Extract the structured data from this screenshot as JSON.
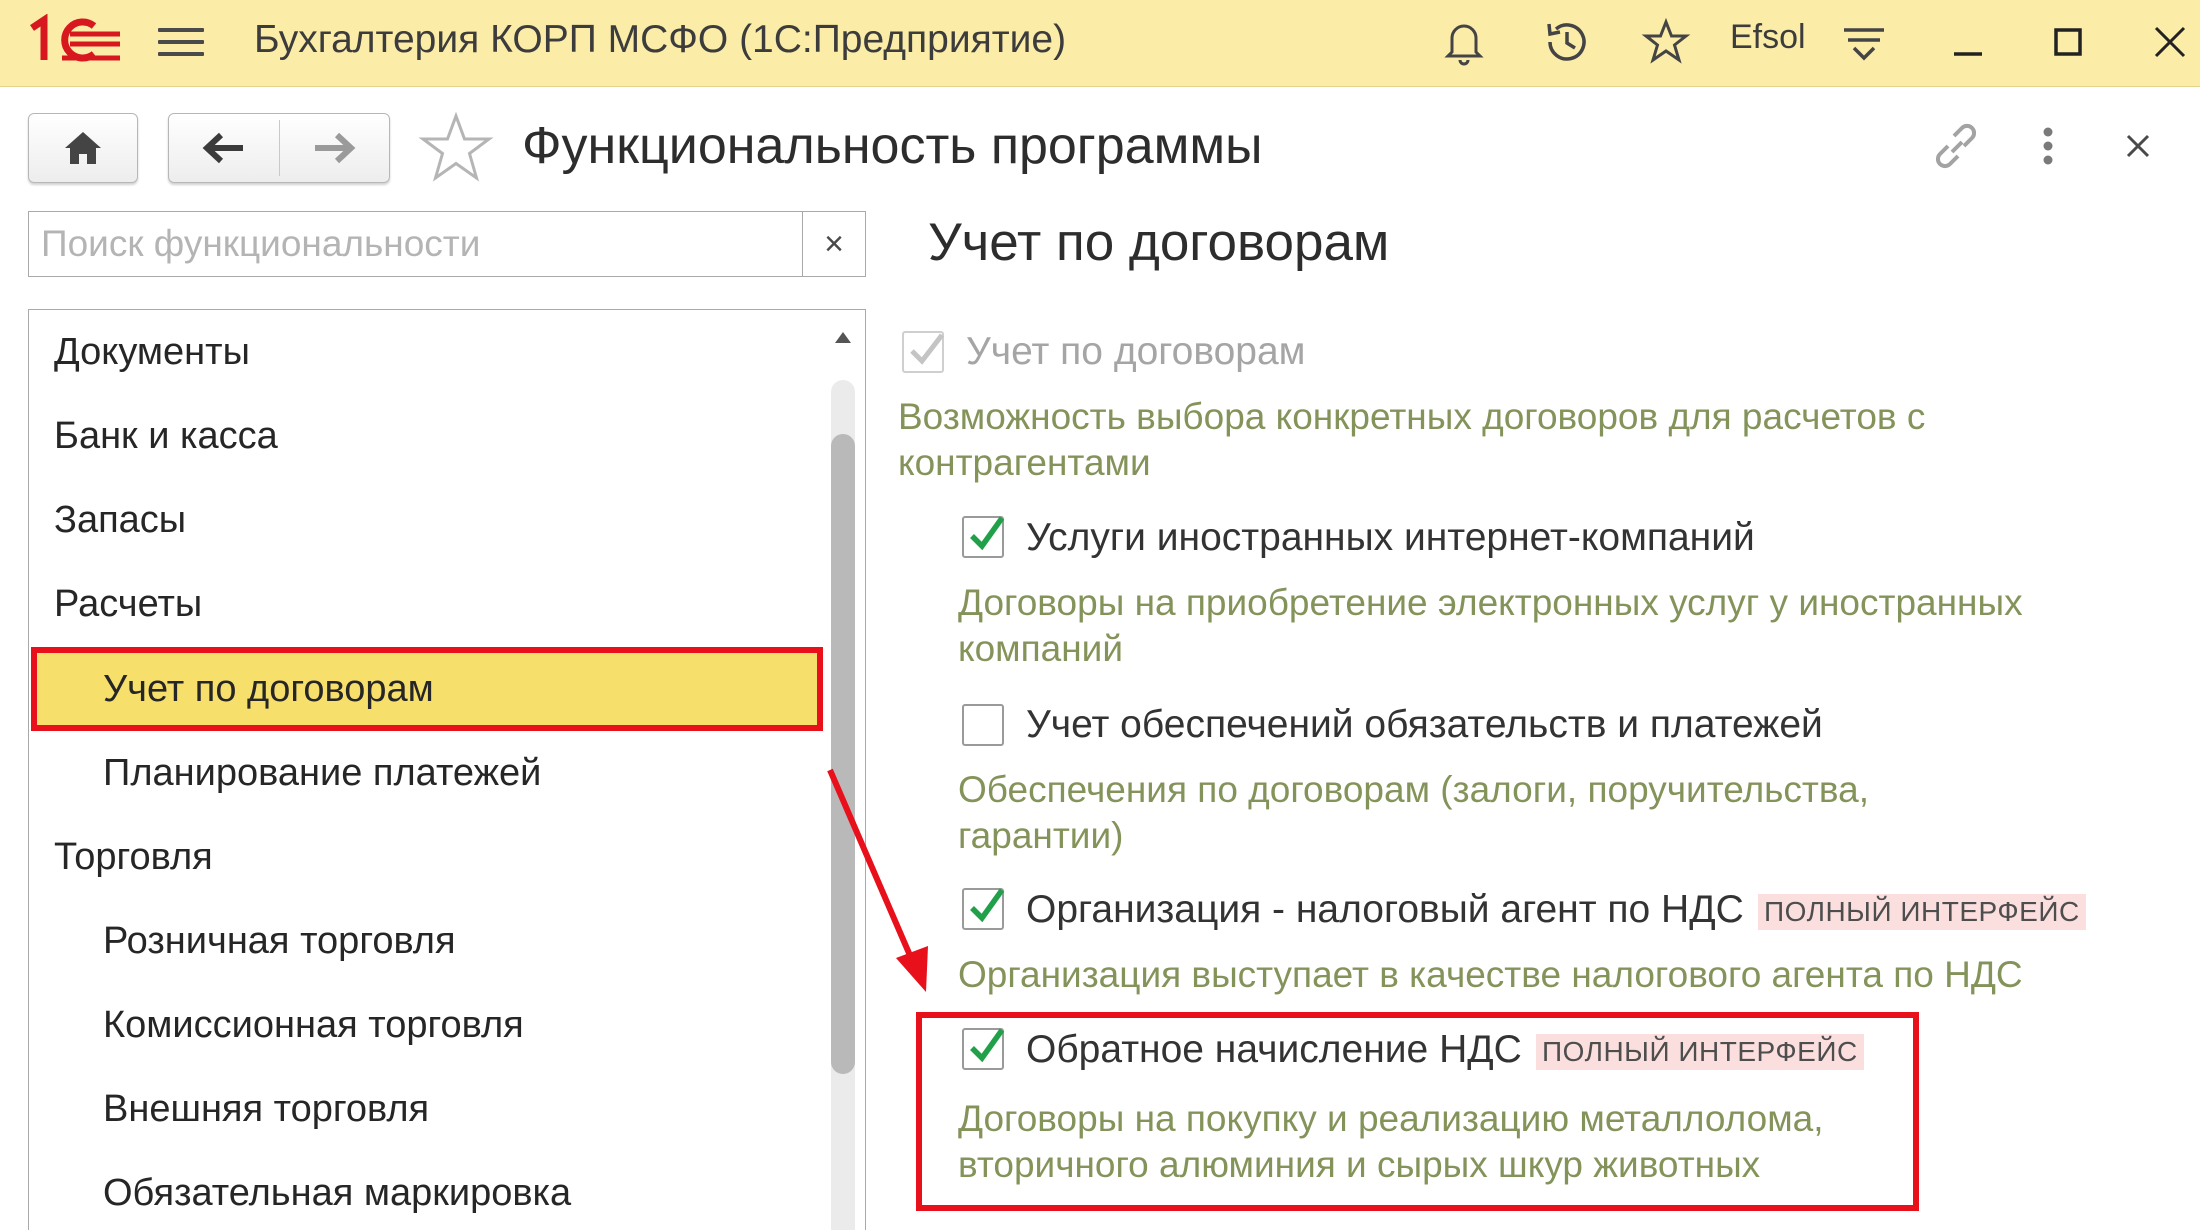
{
  "titlebar": {
    "logo_text": "1С",
    "app_title": "Бухгалтерия КОРП МСФО  (1С:Предприятие)",
    "user": "Efsol",
    "icons": [
      "menu-icon",
      "bell-icon",
      "history-icon",
      "star-icon",
      "settings-lines-icon",
      "minimize-icon",
      "maximize-icon",
      "close-icon"
    ]
  },
  "form": {
    "title": "Функциональность программы",
    "icons": [
      "home-icon",
      "back-arrow-icon",
      "forward-arrow-icon",
      "favorite-star-icon",
      "link-icon",
      "more-icon",
      "close-icon"
    ]
  },
  "search": {
    "placeholder": "Поиск функциональности",
    "value": "",
    "clear_label": "×"
  },
  "tree": {
    "items": [
      {
        "label": "Документы",
        "level": 0
      },
      {
        "label": "Банк и касса",
        "level": 0
      },
      {
        "label": "Запасы",
        "level": 0
      },
      {
        "label": "Расчеты",
        "level": 0
      },
      {
        "label": "Учет по договорам",
        "level": 1,
        "selected": true
      },
      {
        "label": "Планирование платежей",
        "level": 1
      },
      {
        "label": "Торговля",
        "level": 0
      },
      {
        "label": "Розничная торговля",
        "level": 1
      },
      {
        "label": "Комиссионная торговля",
        "level": 1
      },
      {
        "label": "Внешняя торговля",
        "level": 1
      },
      {
        "label": "Обязательная маркировка",
        "level": 1
      }
    ]
  },
  "section": {
    "title": "Учет по договорам",
    "main_option": {
      "label": "Учет по договорам",
      "checked": true,
      "enabled": false,
      "description": "Возможность выбора конкретных договоров для расчетов с контрагентами"
    },
    "options": [
      {
        "label": "Услуги иностранных интернет-компаний",
        "checked": true,
        "description": "Договоры на приобретение электронных услуг у иностранных компаний",
        "badge": ""
      },
      {
        "label": "Учет обеспечений обязательств и платежей",
        "checked": false,
        "description": "Обеспечения по договорам (залоги, поручительства, гарантии)",
        "badge": ""
      },
      {
        "label": "Организация - налоговый агент по НДС",
        "checked": true,
        "description": "Организация выступает в качестве налогового агента по НДС",
        "badge": "ПОЛНЫЙ ИНТЕРФЕЙС"
      },
      {
        "label": "Обратное начисление НДС",
        "checked": true,
        "description": "Договоры на покупку и реализацию металлолома, вторичного алюминия и сырых шкур животных",
        "badge": "ПОЛНЫЙ ИНТЕРФЕЙС"
      }
    ]
  },
  "colors": {
    "titlebar_bg": "#fbeca8",
    "selected_bg": "#f7df6c",
    "highlight_red": "#e8101a",
    "description_green": "#84935a",
    "check_green": "#21a04a",
    "badge_bg": "#fbdede",
    "logo_red": "#d7191f"
  }
}
